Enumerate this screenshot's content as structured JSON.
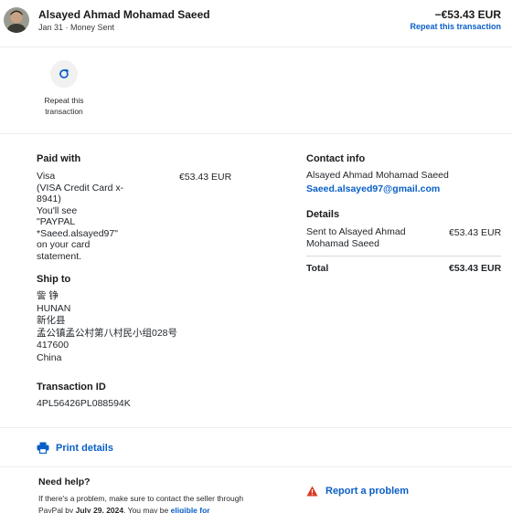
{
  "header": {
    "name": "Alsayed Ahmad Mohamad Saeed",
    "subtitle": "Jan 31 · Money Sent",
    "amount": "−€53.43 EUR",
    "repeat_link": "Repeat this transaction"
  },
  "repeat_button": {
    "icon": "refresh-icon",
    "label_line1": "Repeat this",
    "label_line2": "transaction"
  },
  "paid_with": {
    "title": "Paid with",
    "description": "Visa\n(VISA Credit Card x-\n8941)\nYou'll see\n\"PAYPAL\n*Saeed.alsayed97\"\non your card\nstatement.",
    "amount": "€53.43 EUR"
  },
  "ship_to": {
    "title": "Ship to",
    "address": "訾 铮\nHUNAN\n新化县\n孟公镇孟公村第八村民小组028号\n417600\nChina"
  },
  "transaction": {
    "title": "Transaction ID",
    "id": "4PL56426PL088594K"
  },
  "contact": {
    "title": "Contact info",
    "name": "Alsayed Ahmad Mohamad Saeed",
    "email": "Saeed.alsayed97@gmail.com"
  },
  "details": {
    "title": "Details",
    "sent_to": "Sent to Alsayed Ahmad\nMohamad Saeed",
    "sent_amount": "€53.43 EUR",
    "total_label": "Total",
    "total_amount": "€53.43 EUR"
  },
  "print": {
    "icon": "printer-icon",
    "label": "Print details"
  },
  "help": {
    "title": "Need help?",
    "text_before": "If there's a problem, make sure to contact the seller through PayPal by ",
    "deadline": "July 29, 2024",
    "text_after": ". You may be ",
    "link": "eligible for"
  },
  "problem": {
    "icon": "warning-icon",
    "label": "Report a problem"
  },
  "colors": {
    "link": "#0a5fc6",
    "warning": "#d93a26",
    "text": "#1f2328"
  }
}
